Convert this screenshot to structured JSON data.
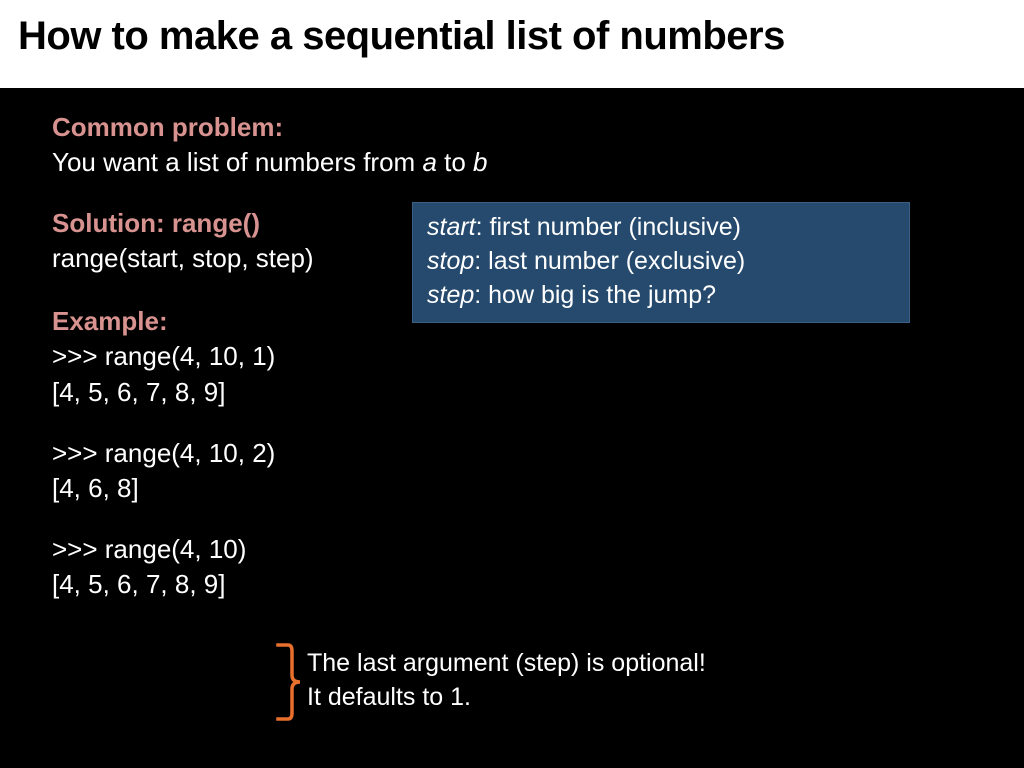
{
  "title": "How to make a sequential list of numbers",
  "problem": {
    "heading": "Common problem:",
    "text_pre": "You want a list of numbers from ",
    "a": "a",
    "mid": " to ",
    "b": "b"
  },
  "solution": {
    "heading": "Solution: range()",
    "signature": "range(start, stop, step)"
  },
  "callout": {
    "start_label": "start",
    "start_desc": ": first number (inclusive)",
    "stop_label": "stop",
    "stop_desc": ": last number (exclusive)",
    "step_label": "step",
    "step_desc": ": how big is the jump?"
  },
  "example": {
    "heading": "Example:",
    "ex1_call": ">>> range(4, 10, 1)",
    "ex1_out": "[4, 5, 6, 7, 8, 9]",
    "ex2_call": ">>> range(4, 10, 2)",
    "ex2_out": "[4, 6, 8]",
    "ex3_call": ">>> range(4, 10)",
    "ex3_out": "[4, 5, 6, 7, 8, 9]"
  },
  "note": {
    "line1": "The last argument (step) is optional!",
    "line2": "It defaults to 1."
  },
  "colors": {
    "heading": "#d89390",
    "callout_bg": "#254a6e",
    "brace": "#e86f2c"
  }
}
